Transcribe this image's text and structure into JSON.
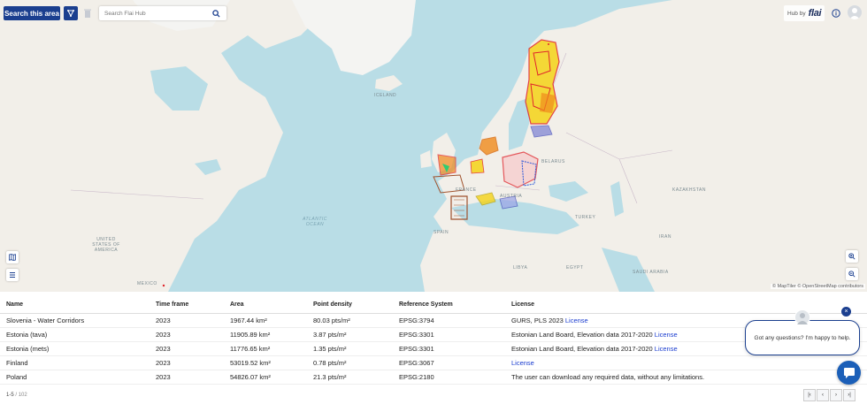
{
  "toolbar": {
    "search_area_label": "Search this area",
    "search_placeholder": "Search Flai Hub",
    "hub_text": "Hub by",
    "hub_logo": "flai"
  },
  "map": {
    "labels": [
      {
        "text": "ICELAND",
        "kind": "land"
      },
      {
        "text": "ATLANTIC OCEAN",
        "kind": "ocean"
      },
      {
        "text": "UNITED STATES OF AMERICA",
        "kind": "land"
      },
      {
        "text": "SPAIN",
        "kind": "land"
      },
      {
        "text": "BELARUS",
        "kind": "land"
      },
      {
        "text": "KAZAKHSTAN",
        "kind": "land"
      },
      {
        "text": "TURKEY",
        "kind": "land"
      },
      {
        "text": "IRAN",
        "kind": "land"
      },
      {
        "text": "EGYPT",
        "kind": "land"
      },
      {
        "text": "AUSTRIA",
        "kind": "land"
      },
      {
        "text": "FRANCE",
        "kind": "land"
      },
      {
        "text": "SAUDI ARABIA",
        "kind": "land"
      },
      {
        "text": "MEXICO",
        "kind": "land"
      },
      {
        "text": "LIBYA",
        "kind": "land"
      }
    ],
    "attribution": "© MapTiler © OpenStreetMap contributors",
    "colors": {
      "water": "#b9dde6",
      "land": "#f2efe9",
      "coverage_red": "#e0242b",
      "coverage_yellow": "#f5d317",
      "coverage_orange": "#f08a1c"
    }
  },
  "table": {
    "columns": [
      "Name",
      "Time frame",
      "Area",
      "Point density",
      "Reference System",
      "License"
    ],
    "rows": [
      {
        "name": "Slovenia - Water Corridors",
        "time": "2023",
        "area": "1967.44 km²",
        "density": "80.03 pts/m²",
        "ref": "EPSG:3794",
        "license_text": "GURS, PLS 2023 ",
        "license_link": "License"
      },
      {
        "name": "Estonia (tava)",
        "time": "2023",
        "area": "11905.89 km²",
        "density": "3.87 pts/m²",
        "ref": "EPSG:3301",
        "license_text": "Estonian Land Board, Elevation data 2017-2020 ",
        "license_link": "License"
      },
      {
        "name": "Estonia (mets)",
        "time": "2023",
        "area": "11776.65 km²",
        "density": "1.35 pts/m²",
        "ref": "EPSG:3301",
        "license_text": "Estonian Land Board, Elevation data 2017-2020 ",
        "license_link": "License"
      },
      {
        "name": "Finland",
        "time": "2023",
        "area": "53019.52 km²",
        "density": "0.78 pts/m²",
        "ref": "EPSG:3067",
        "license_text": "",
        "license_link": "License"
      },
      {
        "name": "Poland",
        "time": "2023",
        "area": "54826.07 km²",
        "density": "21.3 pts/m²",
        "ref": "EPSG:2180",
        "license_text": "The user can download any required data, without any limitations.",
        "license_link": ""
      }
    ]
  },
  "pagination": {
    "range": "1-5",
    "separator": " / ",
    "total": "102",
    "buttons": [
      "|‹",
      "‹",
      "›",
      "›|"
    ]
  },
  "chat": {
    "message": "Got any questions? I'm happy to help.",
    "close": "×"
  }
}
